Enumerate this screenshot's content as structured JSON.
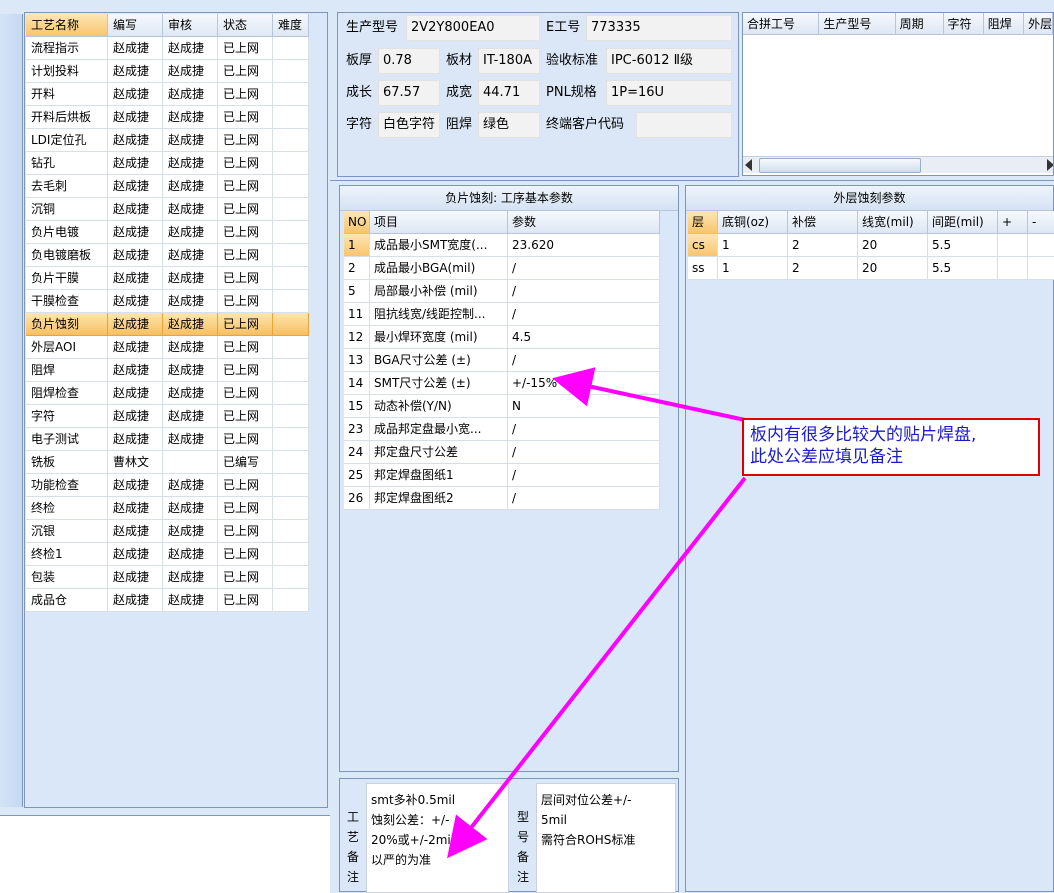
{
  "process_grid": {
    "headers": [
      "工艺名称",
      "编写",
      "审核",
      "状态",
      "难度"
    ],
    "rows": [
      [
        "流程指示",
        "赵成捷",
        "赵成捷",
        "已上网",
        ""
      ],
      [
        "计划投料",
        "赵成捷",
        "赵成捷",
        "已上网",
        ""
      ],
      [
        "开料",
        "赵成捷",
        "赵成捷",
        "已上网",
        ""
      ],
      [
        "开料后烘板",
        "赵成捷",
        "赵成捷",
        "已上网",
        ""
      ],
      [
        "LDI定位孔",
        "赵成捷",
        "赵成捷",
        "已上网",
        ""
      ],
      [
        "钻孔",
        "赵成捷",
        "赵成捷",
        "已上网",
        ""
      ],
      [
        "去毛刺",
        "赵成捷",
        "赵成捷",
        "已上网",
        ""
      ],
      [
        "沉铜",
        "赵成捷",
        "赵成捷",
        "已上网",
        ""
      ],
      [
        "负片电镀",
        "赵成捷",
        "赵成捷",
        "已上网",
        ""
      ],
      [
        "负电镀磨板",
        "赵成捷",
        "赵成捷",
        "已上网",
        ""
      ],
      [
        "负片干膜",
        "赵成捷",
        "赵成捷",
        "已上网",
        ""
      ],
      [
        "干膜检查",
        "赵成捷",
        "赵成捷",
        "已上网",
        ""
      ],
      [
        "负片蚀刻",
        "赵成捷",
        "赵成捷",
        "已上网",
        ""
      ],
      [
        "外层AOI",
        "赵成捷",
        "赵成捷",
        "已上网",
        ""
      ],
      [
        "阻焊",
        "赵成捷",
        "赵成捷",
        "已上网",
        ""
      ],
      [
        "阻焊检查",
        "赵成捷",
        "赵成捷",
        "已上网",
        ""
      ],
      [
        "字符",
        "赵成捷",
        "赵成捷",
        "已上网",
        ""
      ],
      [
        "电子测试",
        "赵成捷",
        "赵成捷",
        "已上网",
        ""
      ],
      [
        "铣板",
        "曹林文",
        "",
        "已编写",
        ""
      ],
      [
        "功能检查",
        "赵成捷",
        "赵成捷",
        "已上网",
        ""
      ],
      [
        "终检",
        "赵成捷",
        "赵成捷",
        "已上网",
        ""
      ],
      [
        "沉银",
        "赵成捷",
        "赵成捷",
        "已上网",
        ""
      ],
      [
        "终检1",
        "赵成捷",
        "赵成捷",
        "已上网",
        ""
      ],
      [
        "包装",
        "赵成捷",
        "赵成捷",
        "已上网",
        ""
      ],
      [
        "成品仓",
        "赵成捷",
        "赵成捷",
        "已上网",
        ""
      ]
    ],
    "selected_index": 12
  },
  "info": {
    "model_label": "生产型号",
    "model_value": "2V2Y800EA0",
    "e_label": "E工号",
    "e_value": "773335",
    "thick_label": "板厚",
    "thick_value": "0.78",
    "material_label": "板材",
    "material_value": "IT-180A",
    "std_label": "验收标准",
    "std_value": "IPC-6012 Ⅱ级",
    "len_label": "成长",
    "len_value": "67.57",
    "wid_label": "成宽",
    "wid_value": "44.71",
    "pnl_label": "PNL规格",
    "pnl_value": "1P=16U",
    "char_label": "字符",
    "char_value": "白色字符",
    "mask_label": "阻焊",
    "mask_value": "绿色",
    "cust_label": "终端客户代码",
    "cust_value": ""
  },
  "merge_grid": {
    "headers": [
      "合拼工号",
      "生产型号",
      "周期",
      "字符",
      "阻焊",
      "外层"
    ]
  },
  "etch_params": {
    "title": "负片蚀刻: 工序基本参数",
    "headers": [
      "NO",
      "项目",
      "参数"
    ],
    "rows": [
      [
        "1",
        "成品最小SMT宽度(...",
        "23.620"
      ],
      [
        "2",
        "成品最小BGA(mil)",
        "/"
      ],
      [
        "5",
        "局部最小补偿 (mil)",
        "/"
      ],
      [
        "11",
        "阻抗线宽/线距控制...",
        "/"
      ],
      [
        "12",
        "最小焊环宽度 (mil)",
        "4.5"
      ],
      [
        "13",
        "BGA尺寸公差 (±)",
        "/"
      ],
      [
        "14",
        "SMT尺寸公差 (±)",
        "+/-15%"
      ],
      [
        "15",
        "动态补偿(Y/N)",
        "N"
      ],
      [
        "23",
        "成品邦定盘最小宽...",
        "/"
      ],
      [
        "24",
        "邦定盘尺寸公差",
        "/"
      ],
      [
        "25",
        "邦定焊盘图纸1",
        "/"
      ],
      [
        "26",
        "邦定焊盘图纸2",
        "/"
      ]
    ]
  },
  "outer_etch": {
    "title": "外层蚀刻参数",
    "headers": [
      "层",
      "底铜(oz)",
      "补偿",
      "线宽(mil)",
      "间距(mil)",
      "+",
      "-"
    ],
    "rows": [
      [
        "cs",
        "1",
        "2",
        "20",
        "5.5",
        "",
        ""
      ],
      [
        "ss",
        "1",
        "2",
        "20",
        "5.5",
        "",
        ""
      ]
    ]
  },
  "notes": {
    "process_label": "工艺备注",
    "process_text": [
      "smt多补0.5mil",
      "蚀刻公差：+/-",
      "20%或+/-2mil",
      "以严的为准"
    ],
    "model_label": "型号备注",
    "model_text": [
      "层间对位公差+/-",
      "5mil",
      "需符合ROHS标准"
    ]
  },
  "annotation": {
    "text_line1": "板内有很多比较大的贴片焊盘,",
    "text_line2": "此处公差应填见备注",
    "color": "#ff00ff",
    "border_color": "#e00000"
  }
}
